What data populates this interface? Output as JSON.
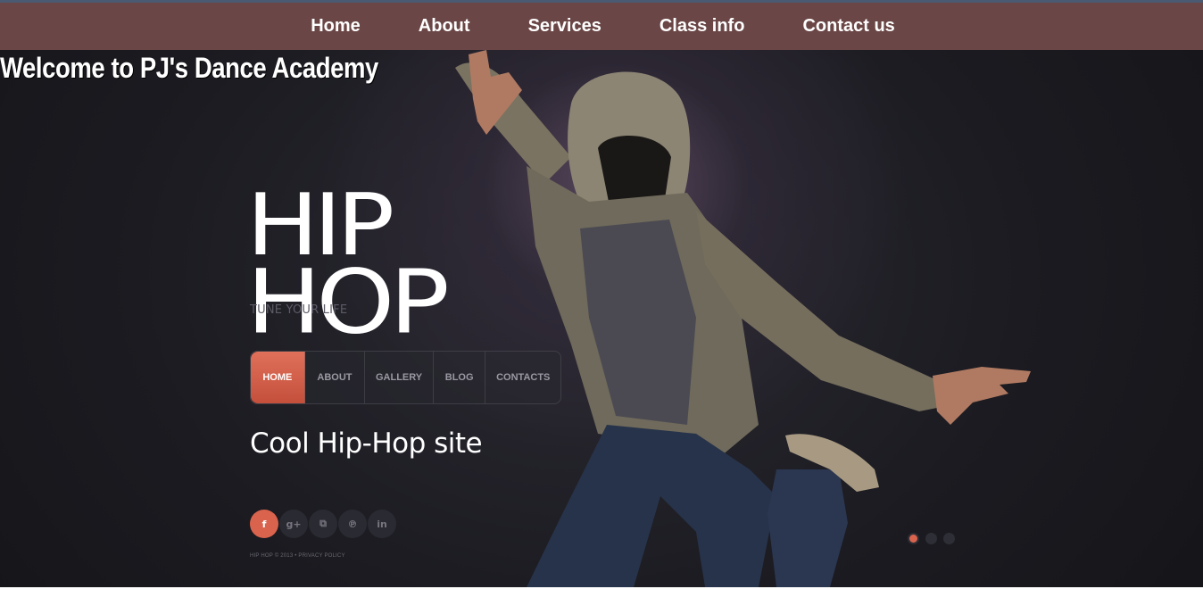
{
  "top_nav": {
    "items": [
      {
        "label": "Home"
      },
      {
        "label": "About"
      },
      {
        "label": "Services"
      },
      {
        "label": "Class info"
      },
      {
        "label": "Contact us"
      }
    ]
  },
  "welcome_heading": "Welcome to PJ's Dance Academy",
  "hero": {
    "logo_line_1": "HIP",
    "logo_line_2": "HOP",
    "tagline": "TUNE YOUR LIFE",
    "menu": [
      {
        "label": "HOME",
        "active": true
      },
      {
        "label": "ABOUT",
        "active": false
      },
      {
        "label": "GALLERY",
        "active": false
      },
      {
        "label": "BLOG",
        "active": false
      },
      {
        "label": "CONTACTS",
        "active": false
      }
    ],
    "headline": "Cool Hip-Hop site",
    "social": [
      {
        "icon": "facebook-icon",
        "glyph": "f"
      },
      {
        "icon": "google-plus-icon",
        "glyph": "g+"
      },
      {
        "icon": "rss-icon",
        "glyph": "⧉"
      },
      {
        "icon": "pinterest-icon",
        "glyph": "℗"
      },
      {
        "icon": "linkedin-icon",
        "glyph": "in"
      }
    ],
    "copyright": "HIP HOP © 2013 • PRIVACY POLICY",
    "slider": {
      "count": 3,
      "active_index": 0
    }
  },
  "colors": {
    "nav_bar": "#6b4646",
    "accent": "#d9634d",
    "hero_bg": "#1b1b21"
  }
}
